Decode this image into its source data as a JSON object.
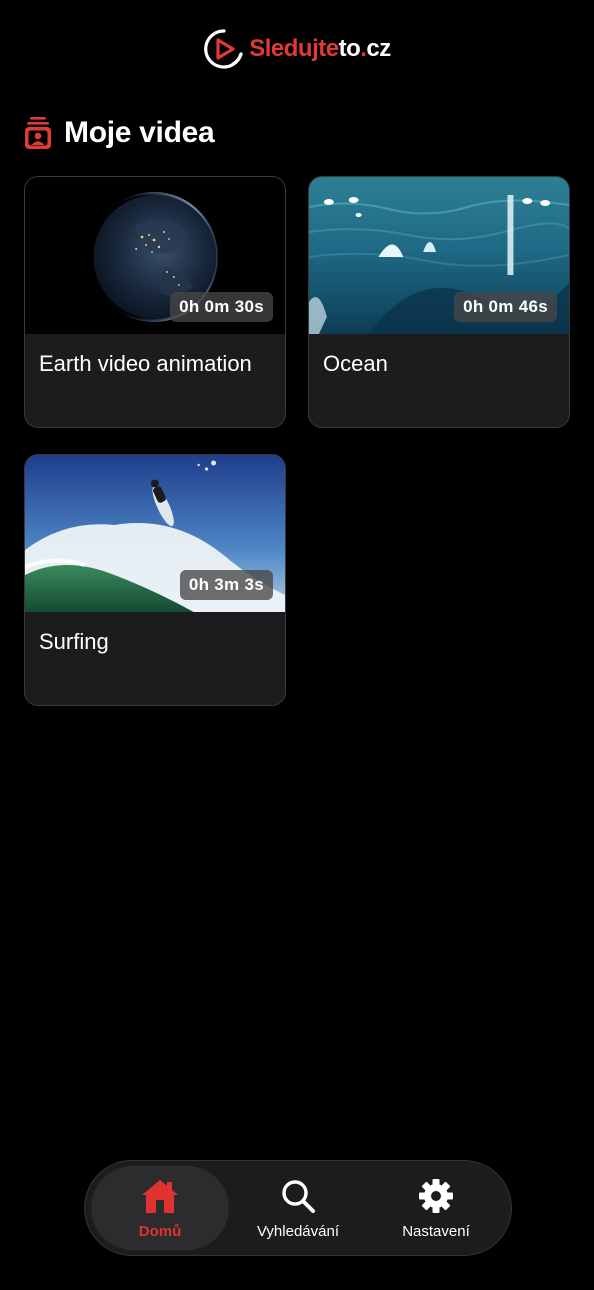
{
  "header": {
    "logo_part1": "Sleduj",
    "logo_part2": "te",
    "logo_part3": "to",
    "logo_dot": ".",
    "logo_part4": "cz",
    "brand_color": "#e03a36"
  },
  "section": {
    "title": "Moje videa",
    "icon": "video-folder-icon"
  },
  "videos": [
    {
      "title": "Earth video animation",
      "duration": "0h 0m 30s",
      "thumbnail": "earth"
    },
    {
      "title": "Ocean",
      "duration": "0h 0m 46s",
      "thumbnail": "ocean"
    },
    {
      "title": "Surfing",
      "duration": "0h 3m 3s",
      "thumbnail": "surfing"
    }
  ],
  "nav": {
    "items": [
      {
        "label": "Domů",
        "icon": "home-icon",
        "active": true
      },
      {
        "label": "Vyhledávání",
        "icon": "search-icon",
        "active": false
      },
      {
        "label": "Nastavení",
        "icon": "gear-icon",
        "active": false
      }
    ],
    "active_color": "#e0322f"
  }
}
